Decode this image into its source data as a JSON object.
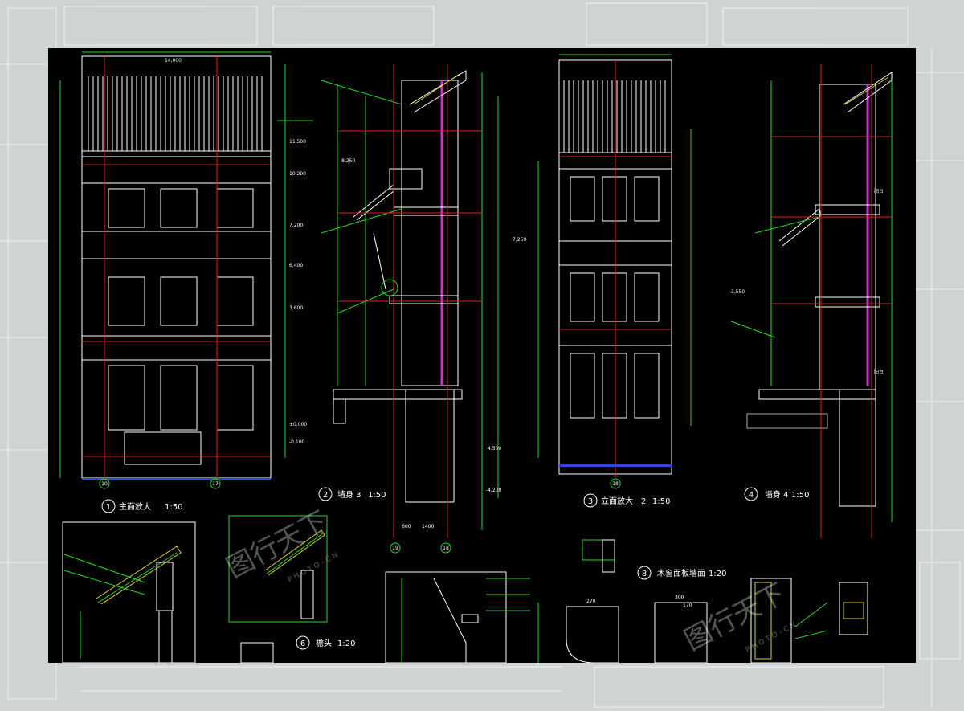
{
  "titles": {
    "t1": {
      "num": "1",
      "text": "主面放大",
      "scale": "1:50"
    },
    "t2": {
      "num": "2",
      "text": "墙身 3",
      "scale": "1:50"
    },
    "t3": {
      "num": "3",
      "text": "立面放大",
      "scale": "2",
      "scale2": "1:50"
    },
    "t4": {
      "num": "4",
      "text": "墙身 4",
      "scale": "1:50"
    },
    "t6": {
      "num": "6",
      "text": "檐头",
      "scale": "1:20"
    },
    "t8": {
      "num": "8",
      "text": "木窗面板墙面",
      "scale": "1:20"
    }
  },
  "axes": {
    "a1": "10",
    "a2": "17",
    "a3": "18",
    "a4": "19"
  },
  "dims": {
    "d1": "14,000",
    "d2": "11,500",
    "d3": "10,200",
    "d4": "7,200",
    "d5": "3,600",
    "d6": "6,400",
    "d7": "-0,100",
    "d8": "±0,000",
    "d9": "4,500",
    "d10": "1400",
    "d11": "600",
    "d12": "270",
    "d13": "300",
    "d14": "170",
    "d15": "8,250",
    "d16": "-4,200",
    "d17": "3,550",
    "d18": "7,250"
  },
  "notes": {
    "n1": "阳台",
    "n2": "阳台"
  },
  "watermark": {
    "main": "图行天下",
    "sub": "PHOTO-CN"
  },
  "colors": {
    "sheet": "#000000",
    "line": "#ffffff",
    "dim": "#22dd22",
    "axis": "#dd2222",
    "accent": "#cc33cc",
    "detail": "#e0d020",
    "backdrop": "#cfd3d3"
  }
}
